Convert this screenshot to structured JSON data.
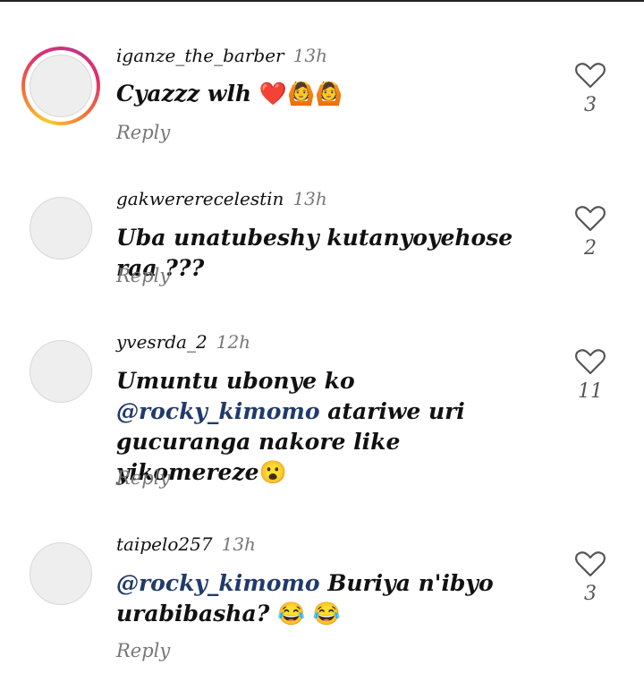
{
  "comments": [
    {
      "username": "iganze_the_barber",
      "time": "13h",
      "text": "Cyazzz wlh ",
      "emoji": "❤️🙆🙆",
      "reply": "Reply",
      "likes": "3",
      "avatar_ring": true
    },
    {
      "username": "gakwererecelestin",
      "time": "13h",
      "text": "Uba unatubeshy kutanyoyehose raa ???",
      "reply": "Reply",
      "likes": "2",
      "avatar_ring": false
    },
    {
      "username": "yvesrda_2",
      "time": "12h",
      "text_before": "Umuntu ubonye ko ",
      "mention": "@rocky_kimomo",
      "text_after": " atariwe uri gucuranga nakore like yikomereze",
      "emoji": "😮",
      "reply": "Reply",
      "likes": "11",
      "avatar_ring": false
    },
    {
      "username": "taipelo257",
      "time": "13h",
      "mention": "@rocky_kimomo",
      "text_after": "  Buriya n'ibyo urabibasha? ",
      "emoji": "😂 😂",
      "reply": "Reply",
      "likes": "3",
      "avatar_ring": false
    }
  ],
  "colors": {
    "mention": "#213a6b",
    "muted": "#777777",
    "avatar_bg": "#eeeeee"
  }
}
